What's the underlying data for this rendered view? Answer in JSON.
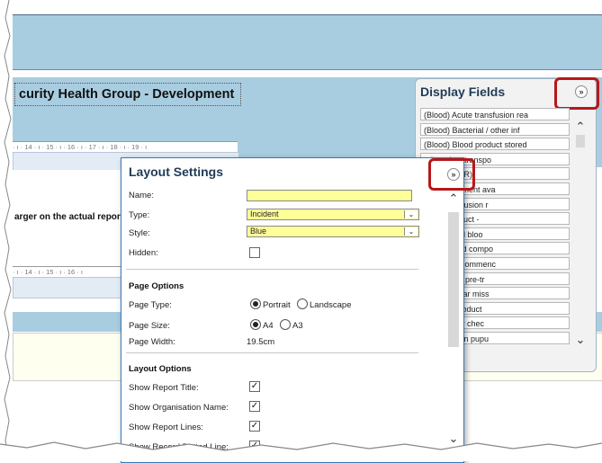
{
  "report": {
    "title": "curity Health Group - Development",
    "ruler1": "· ı · 14 · ı · 15 · ı · 16 · ı · 17 · ı · 18 · ı · 19 · ı",
    "ruler2": "· ı · 14 · ı · 15 · ı · 16 · ı",
    "side_text": "arger on the actual report"
  },
  "display_fields": {
    "title": "Display Fields",
    "items": [
      "(Blood) Acute transfusion rea",
      "(Blood) Bacterial / other inf",
      "(Blood) Blood product stored",
      "od product transpo",
      "nment (STIR)",
      "rrect equipment ava",
      "ayed transfusion r",
      "ails of product -",
      "the hospital bloo",
      "orrect blood compo",
      "estigation commenc",
      "ue with the pre-tr",
      "er STIR near miss",
      "er STIR Product",
      "ient identity chec",
      "t-transfusion pupu"
    ]
  },
  "layout_settings": {
    "title": "Layout Settings",
    "name_label": "Name:",
    "name_value": "",
    "type_label": "Type:",
    "type_value": "Incident",
    "style_label": "Style:",
    "style_value": "Blue",
    "hidden_label": "Hidden:",
    "hidden_checked": false,
    "page_options_title": "Page Options",
    "page_type_label": "Page Type:",
    "portrait_label": "Portrait",
    "landscape_label": "Landscape",
    "page_type_selected": "Portrait",
    "page_size_label": "Page Size:",
    "a4_label": "A4",
    "a3_label": "A3",
    "page_size_selected": "A4",
    "page_width_label": "Page Width:",
    "page_width_value": "19.5cm",
    "layout_options_title": "Layout Options",
    "show_report_title_label": "Show Report Title:",
    "show_org_name_label": "Show Organisation Name:",
    "show_report_lines_label": "Show Report Lines:",
    "show_dotted_line_label": "Show Record Dotted Line:"
  },
  "icons": {
    "expand": "double-chevron-down-icon",
    "scroll_up": "chevron-up-icon",
    "scroll_down": "chevron-down-icon"
  },
  "colors": {
    "band": "#a9cde0",
    "input_highlight": "#ffff99",
    "highlight_box": "#b71818",
    "title_text": "#1f3b57"
  }
}
